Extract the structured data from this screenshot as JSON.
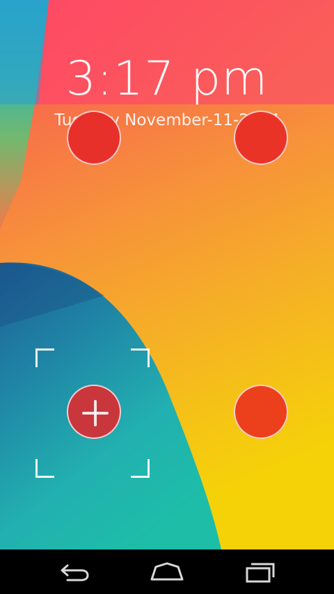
{
  "lockscreen": {
    "time": "3:17 pm",
    "date": "Tuesday November-11-2014"
  },
  "dots": {
    "top_left_color": "#e8302a",
    "top_right_color": "#ea3327",
    "bottom_right_color": "#ec3f1c",
    "bottom_left_color": "#c9363c"
  },
  "icons": {
    "center": "plus-icon",
    "nav_back": "back-icon",
    "nav_home": "home-icon",
    "nav_recents": "recents-icon"
  }
}
